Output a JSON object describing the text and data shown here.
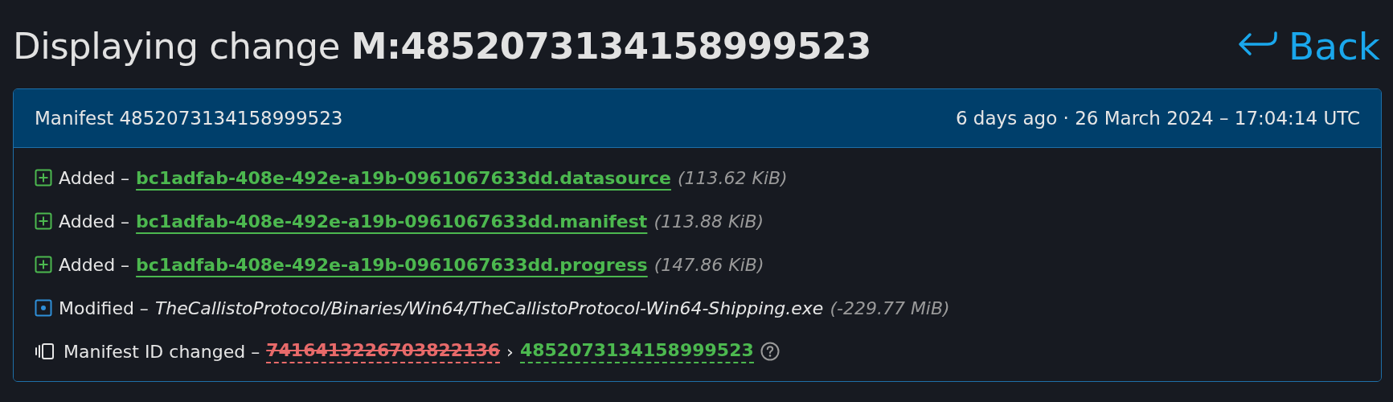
{
  "heading": {
    "prefix": "Displaying change",
    "id": "M:4852073134158999523"
  },
  "back": "Back",
  "card": {
    "title": "Manifest 4852073134158999523",
    "time": "6 days ago · 26 March 2024 – 17:04:14 UTC"
  },
  "changes": [
    {
      "kind": "added",
      "action": "Added –",
      "file": "bc1adfab-408e-492e-a19b-0961067633dd.datasource",
      "size": "(113.62 KiB)"
    },
    {
      "kind": "added",
      "action": "Added –",
      "file": "bc1adfab-408e-492e-a19b-0961067633dd.manifest",
      "size": "(113.88 KiB)"
    },
    {
      "kind": "added",
      "action": "Added –",
      "file": "bc1adfab-408e-492e-a19b-0961067633dd.progress",
      "size": "(147.86 KiB)"
    },
    {
      "kind": "modified",
      "action": "Modified –",
      "file": "TheCallistoProtocol/Binaries/Win64/TheCallistoProtocol-Win64-Shipping.exe",
      "size": "(-229.77 MiB)"
    },
    {
      "kind": "id-change",
      "action": "Manifest ID changed –",
      "old": "7416413226703822136",
      "separator": "›",
      "new": "4852073134158999523"
    }
  ]
}
